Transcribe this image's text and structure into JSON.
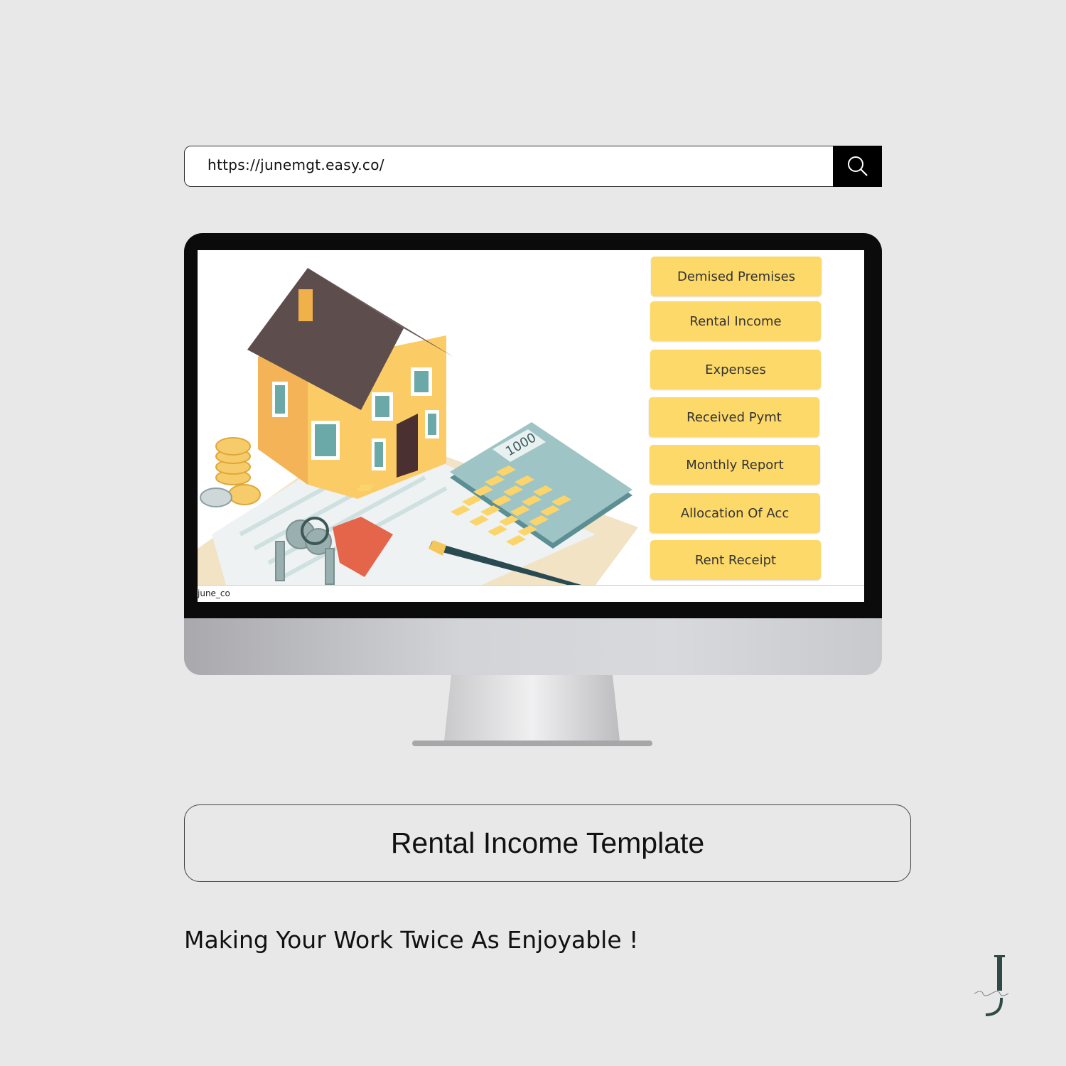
{
  "browser": {
    "url": "https://junemgt.easy.co/",
    "search_icon": "search-icon"
  },
  "screen": {
    "menu": [
      {
        "label": "Demised Premises"
      },
      {
        "label": "Rental Income"
      },
      {
        "label": "Expenses"
      },
      {
        "label": "Received Pymt"
      },
      {
        "label": "Monthly Report"
      },
      {
        "label": "Allocation Of Acc"
      },
      {
        "label": "Rent Receipt"
      }
    ],
    "status_text": "june_co",
    "button_color": "#fdd96a",
    "calculator_display": "1000"
  },
  "title": "Rental Income Template",
  "tagline": "Making Your Work Twice As Enjoyable !",
  "logo": {
    "letter": "J"
  }
}
